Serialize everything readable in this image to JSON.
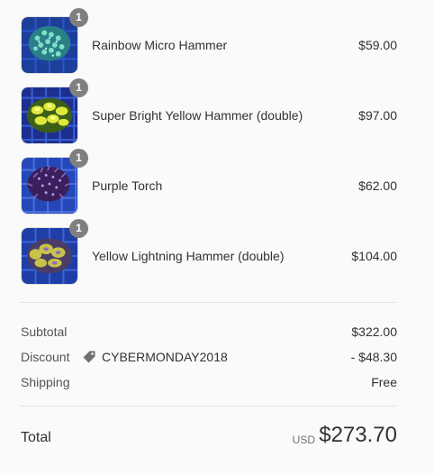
{
  "items": [
    {
      "name": "Rainbow Micro Hammer",
      "price": "$59.00",
      "quantity": "1",
      "image": "coral-rainbow-micro-hammer"
    },
    {
      "name": "Super Bright Yellow Hammer (double)",
      "price": "$97.00",
      "quantity": "1",
      "image": "coral-yellow-hammer"
    },
    {
      "name": "Purple Torch",
      "price": "$62.00",
      "quantity": "1",
      "image": "coral-purple-torch"
    },
    {
      "name": "Yellow Lightning Hammer (double)",
      "price": "$104.00",
      "quantity": "1",
      "image": "coral-yellow-lightning-hammer"
    }
  ],
  "subtotal": {
    "label": "Subtotal",
    "value": "$322.00"
  },
  "discount": {
    "label": "Discount",
    "code": "CYBERMONDAY2018",
    "value": "- $48.30",
    "icon": "tag-icon"
  },
  "shipping": {
    "label": "Shipping",
    "value": "Free"
  },
  "total": {
    "label": "Total",
    "currency": "USD",
    "value": "$273.70"
  },
  "colors": {
    "badge": "#7f7f7f",
    "divider": "#e1e1e1",
    "background": "#fafafa",
    "text": "#323232"
  }
}
